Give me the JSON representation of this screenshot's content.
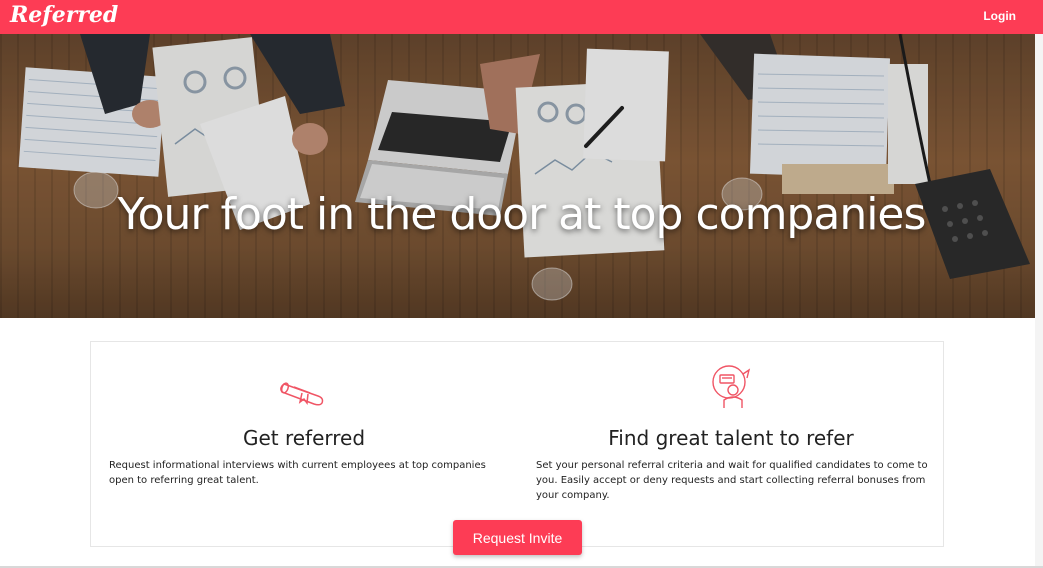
{
  "navbar": {
    "brand": "Referred",
    "login_label": "Login",
    "color": "#fd3c55"
  },
  "hero": {
    "title": "Your foot in the door at top companies"
  },
  "features": [
    {
      "icon": "diploma-scroll-icon",
      "title": "Get referred",
      "description": "Request informational interviews with current employees at top companies open to referring great talent."
    },
    {
      "icon": "referral-person-icon",
      "title": "Find great talent to refer",
      "description": "Set your personal referral criteria and wait for qualified candidates to come to you. Easily accept or deny requests and start collecting referral bonuses from your company."
    }
  ],
  "cta": {
    "label": "Request Invite"
  }
}
